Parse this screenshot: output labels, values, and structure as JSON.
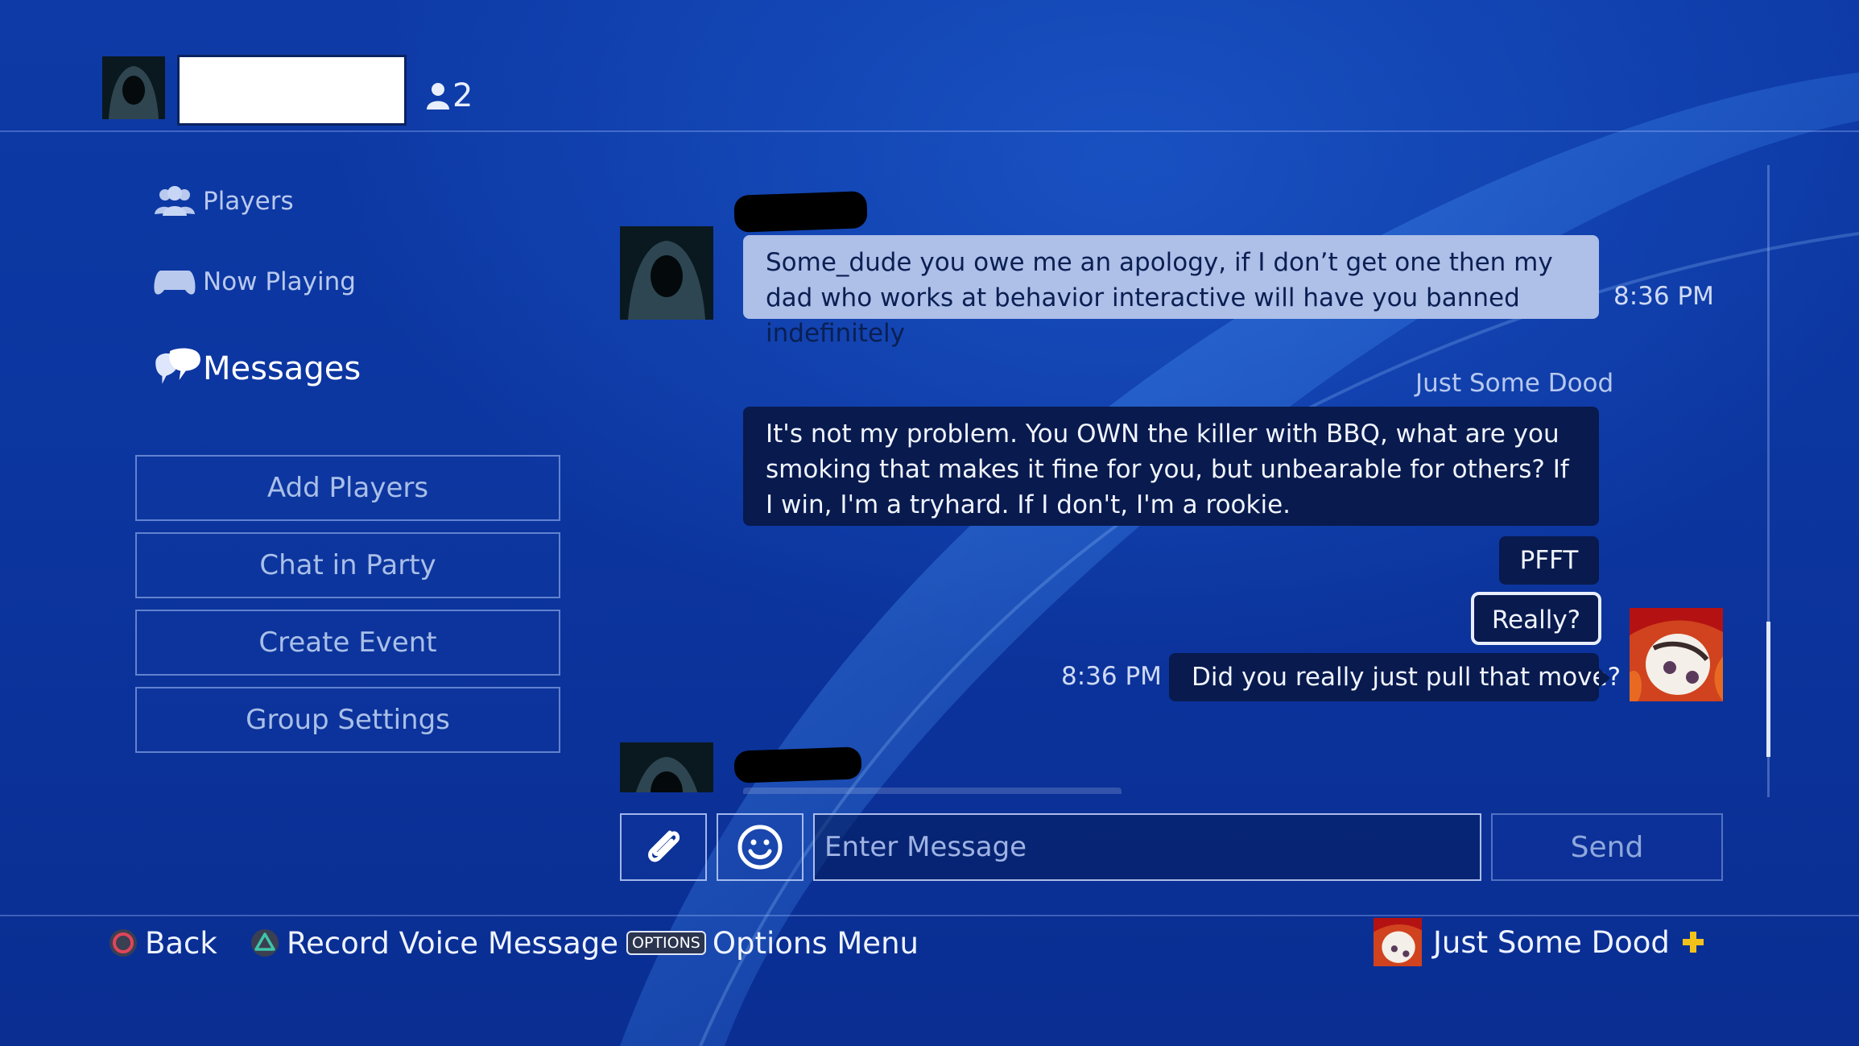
{
  "header": {
    "member_count": "2"
  },
  "nav": {
    "items": [
      {
        "label": "Players",
        "icon": "players-icon"
      },
      {
        "label": "Now Playing",
        "icon": "controller-icon"
      },
      {
        "label": "Messages",
        "icon": "messages-icon",
        "active": true
      }
    ]
  },
  "actions": {
    "buttons": [
      "Add Players",
      "Chat in Party",
      "Create Event",
      "Group Settings"
    ]
  },
  "messages": [
    {
      "side": "left",
      "text": "Some_dude you owe me an apology, if I don’t get one then my dad who works at behavior interactive will have you banned indefinitely",
      "time": "8:36 PM"
    },
    {
      "side": "right",
      "sender": "Just Some Dood",
      "bubbles": [
        "It's not my problem. You OWN the killer with BBQ, what are you smoking that makes it fine for you, but unbearable for others? If I win, I'm a tryhard. If I don't, I'm a rookie.",
        "PFFT",
        "Really?",
        "Did you really just pull that move?"
      ],
      "time": "8:36 PM"
    }
  ],
  "composer": {
    "placeholder": "Enter Message",
    "send_label": "Send",
    "attach_icon": "paperclip-icon",
    "emoji_icon": "smiley-icon"
  },
  "footer": {
    "back_label": "Back",
    "record_label": "Record Voice Message",
    "options_chip": "OPTIONS",
    "options_label": "Options Menu",
    "user_name": "Just Some Dood"
  },
  "colors": {
    "background": "#0c36a0",
    "light_bubble": "#aebfe8",
    "dark_bubble": "#081a4e",
    "circle_button": "#e0455a",
    "triangle_button": "#3fc4a8",
    "plus_badge": "#f2c21b"
  }
}
